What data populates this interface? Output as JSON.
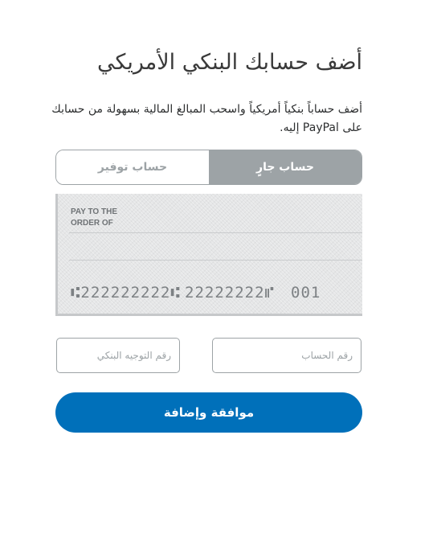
{
  "page": {
    "title": "أضف حسابك البنكي الأمريكي",
    "description": "أضف حساباً بنكياً أمريكياً واسحب المبالغ المالية بسهولة من حسابك على PayPal إليه."
  },
  "account_type": {
    "checking_label": "حساب جارٍ",
    "savings_label": "حساب توفير",
    "selected": "checking"
  },
  "check_image": {
    "pay_to_line1": "PAY TO THE",
    "pay_to_line2": "ORDER OF",
    "routing_digits": "⑆222222222⑆",
    "account_digits": "22222222⑈",
    "check_number": "001"
  },
  "form": {
    "account_number_placeholder": "رقم الحساب",
    "routing_number_placeholder": "رقم التوجيه البنكي",
    "account_number_value": "",
    "routing_number_value": ""
  },
  "actions": {
    "submit_label": "موافقة وإضافة"
  },
  "colors": {
    "primary": "#0070ba",
    "toggle_active": "#9da3a6",
    "text": "#2c2e2f"
  }
}
